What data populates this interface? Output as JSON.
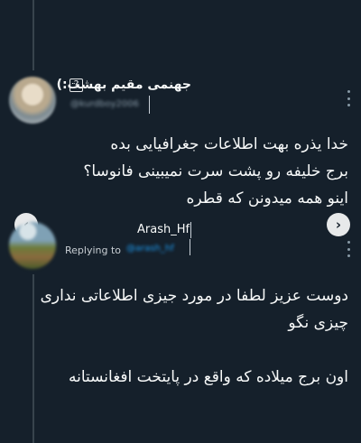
{
  "thread": {
    "tweet1": {
      "display_name": "جهنمی مقیم بهشت:)",
      "emoji_badge": "?",
      "handle": "@kurdboy2006",
      "text_lines": [
        "خدا یذره بهت اطلاعات جغرافیایی بده",
        "برج خلیفه رو پشت سرت نمیبینی فانوسا؟",
        "اینو همه میدونن که قطره"
      ]
    },
    "tweet2": {
      "display_name": "Arash_Hf",
      "replying_to_label": "Replying to",
      "replying_to_handle": "@arash_hf",
      "text_lines": [
        "دوست عزیز لطفا در مورد جیزی اطلاعاتی نداری",
        "چیزی نگو",
        "اون برج میلاده که واقع در پایتخت افغانستانه"
      ]
    },
    "nav": {
      "prev": "‹",
      "next": "›"
    }
  },
  "colors": {
    "background": "#15202b",
    "text": "#f7f9f9",
    "muted": "#8899a6",
    "link": "#1d9bf0"
  }
}
